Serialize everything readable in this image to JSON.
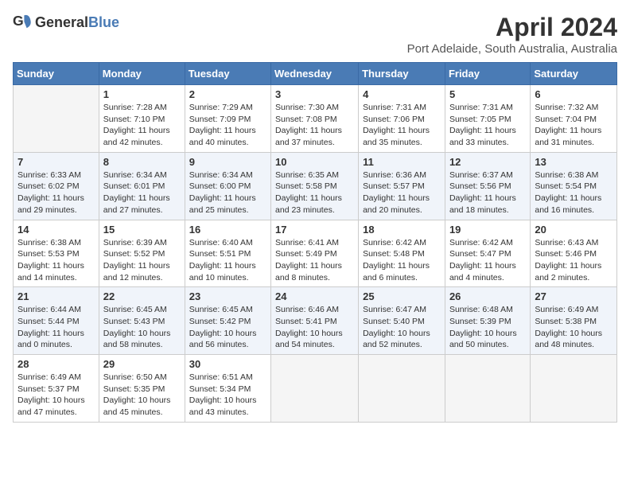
{
  "header": {
    "logo_general": "General",
    "logo_blue": "Blue",
    "month_title": "April 2024",
    "subtitle": "Port Adelaide, South Australia, Australia"
  },
  "days_of_week": [
    "Sunday",
    "Monday",
    "Tuesday",
    "Wednesday",
    "Thursday",
    "Friday",
    "Saturday"
  ],
  "weeks": [
    [
      {
        "day": "",
        "data": ""
      },
      {
        "day": "1",
        "data": "Sunrise: 7:28 AM\nSunset: 7:10 PM\nDaylight: 11 hours\nand 42 minutes."
      },
      {
        "day": "2",
        "data": "Sunrise: 7:29 AM\nSunset: 7:09 PM\nDaylight: 11 hours\nand 40 minutes."
      },
      {
        "day": "3",
        "data": "Sunrise: 7:30 AM\nSunset: 7:08 PM\nDaylight: 11 hours\nand 37 minutes."
      },
      {
        "day": "4",
        "data": "Sunrise: 7:31 AM\nSunset: 7:06 PM\nDaylight: 11 hours\nand 35 minutes."
      },
      {
        "day": "5",
        "data": "Sunrise: 7:31 AM\nSunset: 7:05 PM\nDaylight: 11 hours\nand 33 minutes."
      },
      {
        "day": "6",
        "data": "Sunrise: 7:32 AM\nSunset: 7:04 PM\nDaylight: 11 hours\nand 31 minutes."
      }
    ],
    [
      {
        "day": "7",
        "data": "Sunrise: 6:33 AM\nSunset: 6:02 PM\nDaylight: 11 hours\nand 29 minutes."
      },
      {
        "day": "8",
        "data": "Sunrise: 6:34 AM\nSunset: 6:01 PM\nDaylight: 11 hours\nand 27 minutes."
      },
      {
        "day": "9",
        "data": "Sunrise: 6:34 AM\nSunset: 6:00 PM\nDaylight: 11 hours\nand 25 minutes."
      },
      {
        "day": "10",
        "data": "Sunrise: 6:35 AM\nSunset: 5:58 PM\nDaylight: 11 hours\nand 23 minutes."
      },
      {
        "day": "11",
        "data": "Sunrise: 6:36 AM\nSunset: 5:57 PM\nDaylight: 11 hours\nand 20 minutes."
      },
      {
        "day": "12",
        "data": "Sunrise: 6:37 AM\nSunset: 5:56 PM\nDaylight: 11 hours\nand 18 minutes."
      },
      {
        "day": "13",
        "data": "Sunrise: 6:38 AM\nSunset: 5:54 PM\nDaylight: 11 hours\nand 16 minutes."
      }
    ],
    [
      {
        "day": "14",
        "data": "Sunrise: 6:38 AM\nSunset: 5:53 PM\nDaylight: 11 hours\nand 14 minutes."
      },
      {
        "day": "15",
        "data": "Sunrise: 6:39 AM\nSunset: 5:52 PM\nDaylight: 11 hours\nand 12 minutes."
      },
      {
        "day": "16",
        "data": "Sunrise: 6:40 AM\nSunset: 5:51 PM\nDaylight: 11 hours\nand 10 minutes."
      },
      {
        "day": "17",
        "data": "Sunrise: 6:41 AM\nSunset: 5:49 PM\nDaylight: 11 hours\nand 8 minutes."
      },
      {
        "day": "18",
        "data": "Sunrise: 6:42 AM\nSunset: 5:48 PM\nDaylight: 11 hours\nand 6 minutes."
      },
      {
        "day": "19",
        "data": "Sunrise: 6:42 AM\nSunset: 5:47 PM\nDaylight: 11 hours\nand 4 minutes."
      },
      {
        "day": "20",
        "data": "Sunrise: 6:43 AM\nSunset: 5:46 PM\nDaylight: 11 hours\nand 2 minutes."
      }
    ],
    [
      {
        "day": "21",
        "data": "Sunrise: 6:44 AM\nSunset: 5:44 PM\nDaylight: 11 hours\nand 0 minutes."
      },
      {
        "day": "22",
        "data": "Sunrise: 6:45 AM\nSunset: 5:43 PM\nDaylight: 10 hours\nand 58 minutes."
      },
      {
        "day": "23",
        "data": "Sunrise: 6:45 AM\nSunset: 5:42 PM\nDaylight: 10 hours\nand 56 minutes."
      },
      {
        "day": "24",
        "data": "Sunrise: 6:46 AM\nSunset: 5:41 PM\nDaylight: 10 hours\nand 54 minutes."
      },
      {
        "day": "25",
        "data": "Sunrise: 6:47 AM\nSunset: 5:40 PM\nDaylight: 10 hours\nand 52 minutes."
      },
      {
        "day": "26",
        "data": "Sunrise: 6:48 AM\nSunset: 5:39 PM\nDaylight: 10 hours\nand 50 minutes."
      },
      {
        "day": "27",
        "data": "Sunrise: 6:49 AM\nSunset: 5:38 PM\nDaylight: 10 hours\nand 48 minutes."
      }
    ],
    [
      {
        "day": "28",
        "data": "Sunrise: 6:49 AM\nSunset: 5:37 PM\nDaylight: 10 hours\nand 47 minutes."
      },
      {
        "day": "29",
        "data": "Sunrise: 6:50 AM\nSunset: 5:35 PM\nDaylight: 10 hours\nand 45 minutes."
      },
      {
        "day": "30",
        "data": "Sunrise: 6:51 AM\nSunset: 5:34 PM\nDaylight: 10 hours\nand 43 minutes."
      },
      {
        "day": "",
        "data": ""
      },
      {
        "day": "",
        "data": ""
      },
      {
        "day": "",
        "data": ""
      },
      {
        "day": "",
        "data": ""
      }
    ]
  ]
}
